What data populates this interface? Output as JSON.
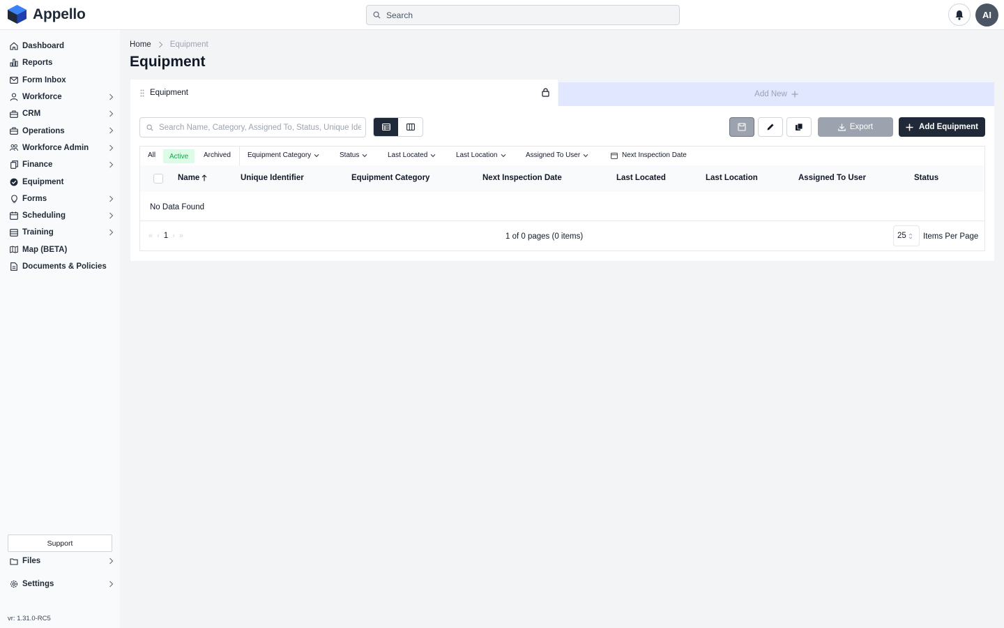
{
  "app": {
    "name": "Appello",
    "brand_color": "#2563eb"
  },
  "search": {
    "placeholder": "Search"
  },
  "user": {
    "initials": "AI"
  },
  "sidebar": {
    "items": [
      {
        "label": "Dashboard",
        "icon": "home-icon",
        "chevron": false
      },
      {
        "label": "Reports",
        "icon": "chart-icon",
        "chevron": false
      },
      {
        "label": "Form Inbox",
        "icon": "mail-icon",
        "chevron": false
      },
      {
        "label": "Workforce",
        "icon": "user-icon",
        "chevron": true
      },
      {
        "label": "CRM",
        "icon": "briefcase-icon",
        "chevron": true
      },
      {
        "label": "Operations",
        "icon": "briefcase-icon",
        "chevron": true
      },
      {
        "label": "Workforce Admin",
        "icon": "users-icon",
        "chevron": true
      },
      {
        "label": "Finance",
        "icon": "copy-icon",
        "chevron": true
      },
      {
        "label": "Equipment",
        "icon": "check-circle-icon",
        "chevron": false
      },
      {
        "label": "Forms",
        "icon": "lightbulb-icon",
        "chevron": true
      },
      {
        "label": "Scheduling",
        "icon": "calendar-icon",
        "chevron": true
      },
      {
        "label": "Training",
        "icon": "book-icon",
        "chevron": true
      },
      {
        "label": "Map (BETA)",
        "icon": "map-icon",
        "chevron": false
      },
      {
        "label": "Documents & Policies",
        "icon": "document-icon",
        "chevron": false
      }
    ],
    "support_label": "Support",
    "files_label": "Files",
    "settings_label": "Settings",
    "version": "vr: 1.31.0-RC5"
  },
  "breadcrumb": {
    "home": "Home",
    "current": "Equipment"
  },
  "page_title": "Equipment",
  "tabs": {
    "active_label": "Equipment",
    "add_label": "Add New"
  },
  "toolbar": {
    "search_placeholder": "Search Name, Category, Assigned To, Status, Unique Identifier",
    "export_label": "Export",
    "add_label": "Add Equipment"
  },
  "filters": {
    "all": "All",
    "active": "Active",
    "archived": "Archived",
    "dropdowns": [
      "Equipment Category",
      "Status",
      "Last Located",
      "Last Location",
      "Assigned To User"
    ],
    "date": "Next Inspection Date"
  },
  "table": {
    "columns": [
      "Name",
      "Unique Identifier",
      "Equipment Category",
      "Next Inspection Date",
      "Last Located",
      "Last Location",
      "Assigned To User",
      "Status"
    ],
    "empty_text": "No Data Found"
  },
  "pagination": {
    "current_page": "1",
    "info": "1 of 0 pages (0 items)",
    "page_size": "25",
    "page_size_label": "Items Per Page"
  }
}
